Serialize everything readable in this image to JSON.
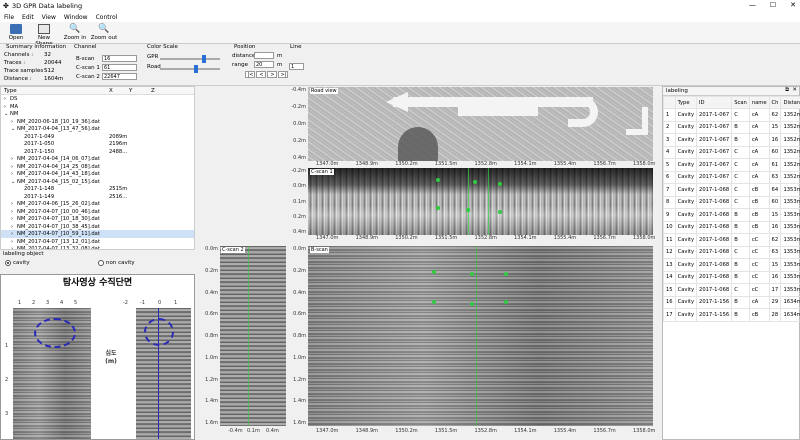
{
  "window": {
    "title": "3D GPR Data labeling"
  },
  "menu": [
    "File",
    "Edit",
    "View",
    "Window",
    "Control"
  ],
  "toolbar": {
    "open": "Open",
    "new_shape": "New Shape",
    "zoom_in": "Zoom in",
    "zoom_out": "Zoom out"
  },
  "summary": {
    "title": "Summary information",
    "channels_label": "Channels :",
    "channels": "32",
    "traces_label": "Traces :",
    "traces": "20044",
    "samples_label": "Trace samples :",
    "samples": "512",
    "distance_label": "Distance :",
    "distance": "1604m"
  },
  "channel": {
    "title": "Channel",
    "bscan_label": "B-scan",
    "bscan": "16",
    "cscan1_label": "C-scan 1",
    "cscan1": "61",
    "cscan2_label": "C-scan 2",
    "cscan2": "22647"
  },
  "color_scale": {
    "title": "Color Scale",
    "gpr_label": "GPR",
    "road_label": "Road",
    "gpr_level": 0.75,
    "road_level": 0.6
  },
  "position": {
    "title": "Position",
    "distance_label": "distance",
    "distance_unit": "m",
    "range_label": "range",
    "range": "20",
    "range_unit": "m",
    "nav": [
      "|<",
      "<",
      ">",
      ">|"
    ]
  },
  "line": {
    "title": "Line",
    "value": "1"
  },
  "tree": {
    "headers": [
      "Type",
      "X",
      "Y",
      "Z"
    ],
    "rows": [
      {
        "name": "DS",
        "x": "",
        "indent": 1,
        "arrow": "›"
      },
      {
        "name": "MA",
        "x": "",
        "indent": 1,
        "arrow": "›"
      },
      {
        "name": "NM",
        "x": "",
        "indent": 1,
        "arrow": "⌄"
      },
      {
        "name": "NM_2020-06-18_[10_19_36].dat",
        "x": "",
        "indent": 2,
        "arrow": "›"
      },
      {
        "name": "NM_2017-04-04_[13_47_56].dat",
        "x": "",
        "indent": 2,
        "arrow": "⌄"
      },
      {
        "name": "2017-1-049",
        "x": "2089m",
        "indent": 3,
        "arrow": ""
      },
      {
        "name": "2017-1-050",
        "x": "2196m",
        "indent": 3,
        "arrow": ""
      },
      {
        "name": "2017-1-150",
        "x": "2488...",
        "indent": 3,
        "arrow": ""
      },
      {
        "name": "NM_2017-04-04_[14_06_07].dat",
        "x": "",
        "indent": 2,
        "arrow": "›"
      },
      {
        "name": "NM_2017-04-04_[14_25_08].dat",
        "x": "",
        "indent": 2,
        "arrow": "›"
      },
      {
        "name": "NM_2017-04-04_[14_43_18].dat",
        "x": "",
        "indent": 2,
        "arrow": "›"
      },
      {
        "name": "NM_2017-04-04_[15_02_15].dat",
        "x": "",
        "indent": 2,
        "arrow": "⌄"
      },
      {
        "name": "2017-1-148",
        "x": "2515m",
        "indent": 3,
        "arrow": ""
      },
      {
        "name": "2017-1-149",
        "x": "2516...",
        "indent": 3,
        "arrow": ""
      },
      {
        "name": "NM_2017-04-06_[15_26_02].dat",
        "x": "",
        "indent": 2,
        "arrow": "›"
      },
      {
        "name": "NM_2017-04-07_[10_00_46].dat",
        "x": "",
        "indent": 2,
        "arrow": "›"
      },
      {
        "name": "NM_2017-04-07_[10_18_30].dat",
        "x": "",
        "indent": 2,
        "arrow": "›"
      },
      {
        "name": "NM_2017-04-07_[10_38_45].dat",
        "x": "",
        "indent": 2,
        "arrow": "›"
      },
      {
        "name": "NM_2017-04-07_[10_59_11].dat",
        "x": "",
        "indent": 2,
        "arrow": "›",
        "selected": true
      },
      {
        "name": "NM_2017-04-07_[13_12_01].dat",
        "x": "",
        "indent": 2,
        "arrow": "›"
      },
      {
        "name": "NM_2017-04-07_[13_32_08].dat",
        "x": "",
        "indent": 2,
        "arrow": "›"
      }
    ]
  },
  "labeling_object": {
    "title": "labeling object",
    "cavity": "cavity",
    "non_cavity": "non cavity"
  },
  "korean_image": {
    "title": "탐사영상  수직단면",
    "left_ticks_x": [
      "1",
      "2",
      "3",
      "4",
      "5"
    ],
    "right_ticks_x": [
      "-2",
      "-1",
      "0",
      "1"
    ],
    "ticks_y": [
      "1",
      "2",
      "3"
    ],
    "depth_label": "심도 (m)"
  },
  "road_view": {
    "title": "Road view",
    "xticks": [
      "1347.0m",
      "1348.9m",
      "1350.2m",
      "1351.5m",
      "1352.8m",
      "1354.1m",
      "1355.4m",
      "1356.7m",
      "1358.0m"
    ],
    "yticks": [
      "-0.4m",
      "-0.2m",
      "0.0m",
      "0.2m",
      "0.4m"
    ]
  },
  "cscan1": {
    "title": "C-scan 1",
    "xticks": [
      "1347.0m",
      "1348.9m",
      "1350.2m",
      "1351.5m",
      "1352.8m",
      "1354.1m",
      "1355.4m",
      "1356.7m",
      "1358.0m"
    ],
    "yticks": [
      "-0.2m",
      "0.0m",
      "0.1m",
      "0.2m",
      "0.4m"
    ]
  },
  "cscan2": {
    "title": "C-scan 2",
    "yticks": [
      "0.0m",
      "0.2m",
      "0.4m",
      "0.6m",
      "0.8m",
      "1.0m",
      "1.2m",
      "1.4m",
      "1.6m"
    ],
    "xticks": [
      "-0.4m",
      "0.1m",
      "0.4m"
    ]
  },
  "bscan": {
    "title": "B-scan",
    "xticks": [
      "1347.0m",
      "1348.9m",
      "1350.2m",
      "1351.5m",
      "1352.8m",
      "1354.1m",
      "1355.4m",
      "1356.7m",
      "1358.0m"
    ],
    "yticks": [
      "0.0m",
      "0.2m",
      "0.4m",
      "0.6m",
      "0.8m",
      "1.0m",
      "1.2m",
      "1.4m",
      "1.6m"
    ]
  },
  "labeling": {
    "title": "labeling",
    "headers": [
      "",
      "Type",
      "ID",
      "Scan",
      "name",
      "Ch",
      "Distance"
    ],
    "rows": [
      [
        "1",
        "Cavity",
        "2017-1-067",
        "C",
        "cA",
        "62",
        "1352m"
      ],
      [
        "2",
        "Cavity",
        "2017-1-067",
        "B",
        "cA",
        "15",
        "1352m"
      ],
      [
        "3",
        "Cavity",
        "2017-1-067",
        "B",
        "cA",
        "16",
        "1352m"
      ],
      [
        "4",
        "Cavity",
        "2017-1-067",
        "C",
        "cA",
        "60",
        "1352m"
      ],
      [
        "5",
        "Cavity",
        "2017-1-067",
        "C",
        "cA",
        "61",
        "1352m"
      ],
      [
        "6",
        "Cavity",
        "2017-1-067",
        "C",
        "cA",
        "63",
        "1352m"
      ],
      [
        "7",
        "Cavity",
        "2017-1-068",
        "C",
        "cB",
        "64",
        "1353m"
      ],
      [
        "8",
        "Cavity",
        "2017-1-068",
        "C",
        "cB",
        "60",
        "1353m"
      ],
      [
        "9",
        "Cavity",
        "2017-1-068",
        "B",
        "cB",
        "15",
        "1353m"
      ],
      [
        "10",
        "Cavity",
        "2017-1-068",
        "B",
        "cB",
        "16",
        "1353m"
      ],
      [
        "11",
        "Cavity",
        "2017-1-068",
        "B",
        "cC",
        "62",
        "1353m"
      ],
      [
        "12",
        "Cavity",
        "2017-1-068",
        "C",
        "cC",
        "63",
        "1353m"
      ],
      [
        "13",
        "Cavity",
        "2017-1-068",
        "B",
        "cC",
        "15",
        "1353m"
      ],
      [
        "14",
        "Cavity",
        "2017-1-068",
        "B",
        "cC",
        "16",
        "1353m"
      ],
      [
        "15",
        "Cavity",
        "2017-1-068",
        "C",
        "cC",
        "17",
        "1353m"
      ],
      [
        "16",
        "Cavity",
        "2017-1-156",
        "B",
        "cA",
        "29",
        "1634m"
      ],
      [
        "17",
        "Cavity",
        "2017-1-156",
        "B",
        "cB",
        "28",
        "1634m"
      ]
    ]
  },
  "colors": {
    "selected_row": "#cfe1f7",
    "marker": "#2ecc40",
    "accent": "#2a6fd6"
  }
}
